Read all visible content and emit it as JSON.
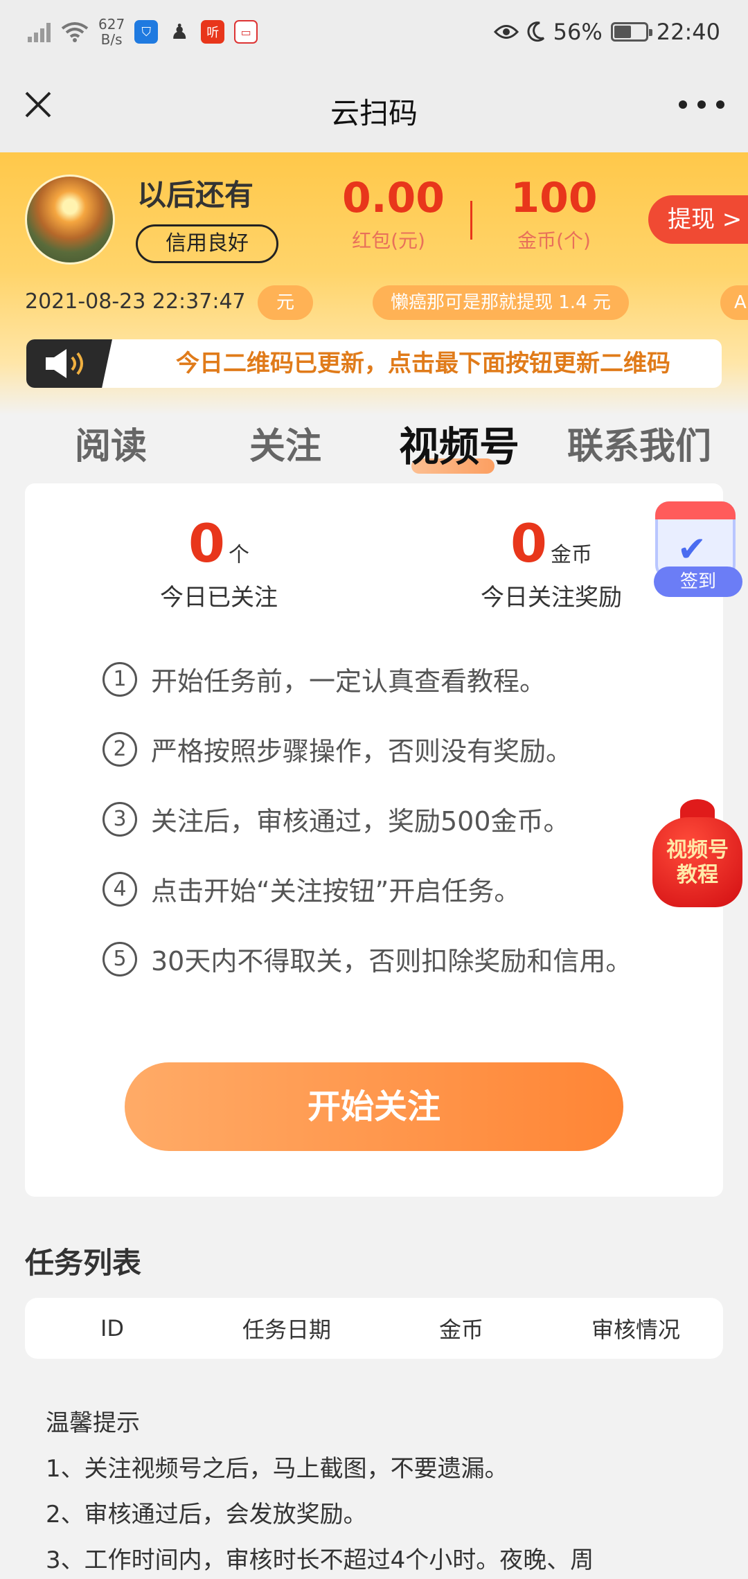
{
  "status_bar": {
    "net_speed_value": "627",
    "net_speed_unit": "B/s",
    "app_icon_ting": "听",
    "battery_percent": "56%",
    "battery_level": 0.56,
    "time": "22:40"
  },
  "title_bar": {
    "title": "云扫码"
  },
  "profile": {
    "name": "以后还有",
    "credit_badge": "信用良好",
    "red_packet_value": "0.00",
    "red_packet_label": "红包(元)",
    "coins_value": "100",
    "coins_label": "金币(个)",
    "withdraw_label": "提现 >"
  },
  "ticker": {
    "timestamp": "2021-08-23 22:37:47",
    "pill_left": "元",
    "pill_main": "懒癌那可是那就提现  1.4  元",
    "pill_right": "A"
  },
  "notice": {
    "text": "今日二维码已更新，点击最下面按钮更新二维码"
  },
  "tabs": [
    {
      "label": "阅读"
    },
    {
      "label": "关注"
    },
    {
      "label": "视频号"
    },
    {
      "label": "联系我们"
    }
  ],
  "stats": {
    "followed_value": "0",
    "followed_unit": "个",
    "followed_label": "今日已关注",
    "reward_value": "0",
    "reward_unit": "金币",
    "reward_label": "今日关注奖励"
  },
  "rules": [
    {
      "idx": "1",
      "text": "开始任务前，一定认真查看教程。"
    },
    {
      "idx": "2",
      "text": "严格按照步骤操作，否则没有奖励。"
    },
    {
      "idx": "3",
      "text": "关注后，审核通过，奖励500金币。"
    },
    {
      "idx": "4",
      "text": "点击开始“关注按钮”开启任务。"
    },
    {
      "idx": "5",
      "text": "30天内不得取关，否则扣除奖励和信用。"
    }
  ],
  "start_button": "开始关注",
  "sign_in_badge": "签到",
  "tutorial_bag": {
    "line1": "视频号",
    "line2": "教程"
  },
  "task_list": {
    "title": "任务列表",
    "columns": [
      "ID",
      "任务日期",
      "金币",
      "审核情况"
    ]
  },
  "tips": {
    "title": "温馨提示",
    "items": [
      "1、关注视频号之后，马上截图，不要遗漏。",
      "2、审核通过后，会发放奖励。",
      "3、工作时间内，审核时长不超过4个小时。夜晚、周"
    ]
  },
  "colors": {
    "accent_red": "#e8361b",
    "accent_orange": "#ff8535",
    "header_yellow": "#ffc84a"
  }
}
